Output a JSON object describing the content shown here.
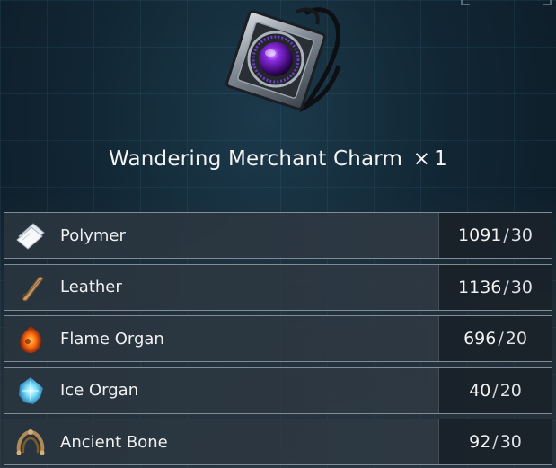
{
  "item": {
    "name": "Wandering Merchant Charm",
    "multiplier": "×",
    "quantity": "1",
    "icon": "charm-icon"
  },
  "materials": [
    {
      "name": "Polymer",
      "owned": "1091",
      "required": "30",
      "icon": "polymer-icon"
    },
    {
      "name": "Leather",
      "owned": "1136",
      "required": "30",
      "icon": "leather-icon"
    },
    {
      "name": "Flame Organ",
      "owned": "696",
      "required": "20",
      "icon": "flame-organ-icon"
    },
    {
      "name": "Ice Organ",
      "owned": "40",
      "required": "20",
      "icon": "ice-organ-icon"
    },
    {
      "name": "Ancient Bone",
      "owned": "92",
      "required": "30",
      "icon": "ancient-bone-icon"
    }
  ],
  "separator": "/",
  "colors": {
    "background": "#112633",
    "row": "#303a44",
    "gem": "#7a2ad8",
    "text": "#f0f0f0"
  }
}
